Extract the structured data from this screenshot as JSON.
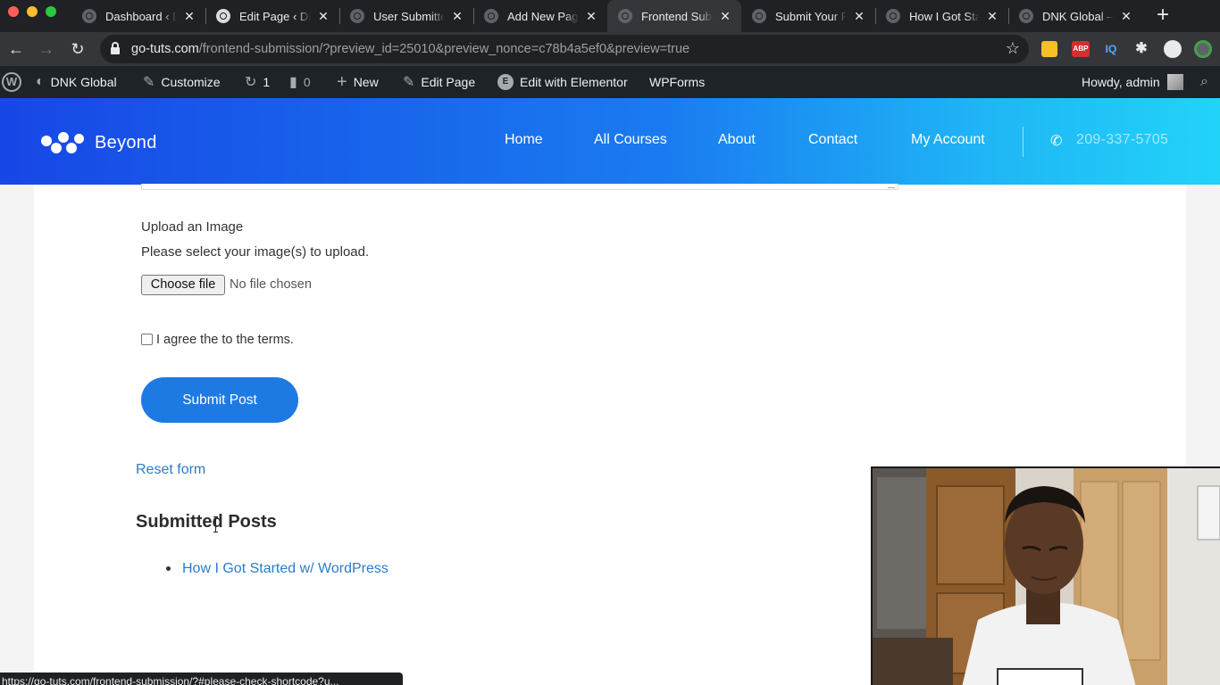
{
  "browser": {
    "tabs": [
      {
        "title": "Dashboard ‹ DNK Global",
        "active": false
      },
      {
        "title": "Edit Page ‹ DNK Global",
        "active": false
      },
      {
        "title": "User Submitted Posts",
        "active": false
      },
      {
        "title": "Add New Page",
        "active": false
      },
      {
        "title": "Frontend Submission",
        "active": true
      },
      {
        "title": "Submit Your Post",
        "active": false
      },
      {
        "title": "How I Got Started",
        "active": false
      },
      {
        "title": "DNK Global –",
        "active": false
      }
    ],
    "url_host": "go-tuts.com",
    "url_path": "/frontend-submission/?preview_id=25010&preview_nonce=c78b4a5ef0&preview=true",
    "extensions": {
      "abp": "ABP",
      "iq": "IQ"
    }
  },
  "adminbar": {
    "site_name": "DNK Global",
    "customize": "Customize",
    "updates_count": "1",
    "comments_count": "0",
    "new": "New",
    "edit_page": "Edit Page",
    "elementor": "Edit with Elementor",
    "wpforms": "WPForms",
    "greeting": "Howdy, admin"
  },
  "site": {
    "logo_text": "Beyond",
    "menu": [
      "Home",
      "All Courses",
      "About",
      "Contact",
      "My Account"
    ],
    "phone": "209-337-5705",
    "colors": {
      "header_start": "#1747e6",
      "header_end": "#22d3f8",
      "button": "#1e7ae3",
      "link": "#2a7ccc"
    }
  },
  "form": {
    "upload_label": "Upload an Image",
    "upload_desc": "Please select your image(s) to upload.",
    "file_button": "Choose file",
    "file_status": "No file chosen",
    "terms_label": "I agree the to the terms.",
    "terms_checked": false,
    "submit_label": "Submit Post",
    "reset_label": "Reset form"
  },
  "submitted": {
    "heading": "Submitted Posts",
    "posts": [
      "How I Got Started w/ WordPress"
    ]
  },
  "status_url": "https://go-tuts.com/frontend-submission/?#please-check-shortcode?u..."
}
